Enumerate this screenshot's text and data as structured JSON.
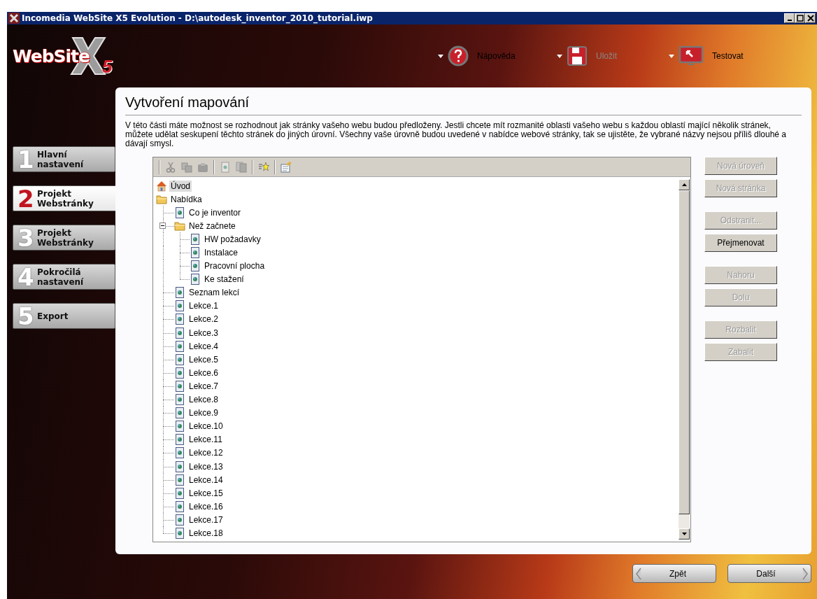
{
  "window": {
    "title": "Incomedia WebSite X5 Evolution - D:\\autodesk_inventor_2010_tutorial.iwp"
  },
  "logo": {
    "text": "WebSite",
    "number": "5"
  },
  "header_actions": [
    {
      "kind": "help",
      "label": "Nápověda",
      "disabled": false
    },
    {
      "kind": "save",
      "label": "Uložit",
      "disabled": true
    },
    {
      "kind": "test",
      "label": "Testovat",
      "disabled": false
    }
  ],
  "steps": [
    {
      "number": "1",
      "label": "Hlavní nastavení",
      "selected": false
    },
    {
      "number": "2",
      "label": "Projekt Webstránky",
      "selected": true
    },
    {
      "number": "3",
      "label": "Projekt Webstránky",
      "selected": false
    },
    {
      "number": "4",
      "label": "Pokročilá nastavení",
      "selected": false
    },
    {
      "number": "5",
      "label": "Export",
      "selected": false
    }
  ],
  "page": {
    "title": "Vytvoření mapování",
    "description": "V této části máte možnost se rozhodnout jak stránky vašeho webu budou předloženy. Jestli chcete mít rozmanité oblasti vašeho webu s každou oblastí mající několik stránek, můžete udělat seskupení těchto stránek do jiných úrovní. Všechny vaše úrovně budou uvedené v nabídce webové stránky, tak se ujistěte, že vybrané názvy nejsou příliš dlouhé a dávají smysl."
  },
  "toolbar": [
    {
      "kind": "cut",
      "disabled": true
    },
    {
      "kind": "copy",
      "disabled": true
    },
    {
      "kind": "paste",
      "disabled": true
    },
    {
      "kind": "separator"
    },
    {
      "kind": "page",
      "disabled": true
    },
    {
      "kind": "pages",
      "disabled": true
    },
    {
      "kind": "separator"
    },
    {
      "kind": "star",
      "disabled": false
    },
    {
      "kind": "separator"
    },
    {
      "kind": "properties",
      "disabled": false
    }
  ],
  "tree": [
    {
      "label": "Úvod",
      "kind": "home",
      "selected": true
    },
    {
      "label": "Nabídka",
      "kind": "folder",
      "selected": false,
      "children": [
        {
          "label": "Co je inventor",
          "kind": "page",
          "selected": false
        },
        {
          "label": "Než začnete",
          "kind": "folder",
          "selected": false,
          "children": [
            {
              "label": "HW požadavky",
              "kind": "page",
              "selected": false
            },
            {
              "label": "Instalace",
              "kind": "page",
              "selected": false
            },
            {
              "label": "Pracovní plocha",
              "kind": "page",
              "selected": false
            },
            {
              "label": "Ke stažení",
              "kind": "page",
              "selected": false
            }
          ]
        },
        {
          "label": "Seznam lekcí",
          "kind": "page",
          "selected": false
        },
        {
          "label": "Lekce.1",
          "kind": "page",
          "selected": false
        },
        {
          "label": "Lekce.2",
          "kind": "page",
          "selected": false
        },
        {
          "label": "Lekce.3",
          "kind": "page",
          "selected": false
        },
        {
          "label": "Lekce.4",
          "kind": "page",
          "selected": false
        },
        {
          "label": "Lekce.5",
          "kind": "page",
          "selected": false
        },
        {
          "label": "Lekce.6",
          "kind": "page",
          "selected": false
        },
        {
          "label": "Lekce.7",
          "kind": "page",
          "selected": false
        },
        {
          "label": "Lekce.8",
          "kind": "page",
          "selected": false
        },
        {
          "label": "Lekce.9",
          "kind": "page",
          "selected": false
        },
        {
          "label": "Lekce.10",
          "kind": "page",
          "selected": false
        },
        {
          "label": "Lekce.11",
          "kind": "page",
          "selected": false
        },
        {
          "label": "Lekce.12",
          "kind": "page",
          "selected": false
        },
        {
          "label": "Lekce.13",
          "kind": "page",
          "selected": false
        },
        {
          "label": "Lekce.14",
          "kind": "page",
          "selected": false
        },
        {
          "label": "Lekce.15",
          "kind": "page",
          "selected": false
        },
        {
          "label": "Lekce.16",
          "kind": "page",
          "selected": false
        },
        {
          "label": "Lekce.17",
          "kind": "page",
          "selected": false
        },
        {
          "label": "Lekce.18",
          "kind": "page",
          "selected": false
        }
      ]
    }
  ],
  "side_button_groups": [
    [
      {
        "label": "Nová úroveň",
        "disabled": true
      },
      {
        "label": "Nová stránka",
        "disabled": true
      }
    ],
    [
      {
        "label": "Odstranit...",
        "disabled": true
      },
      {
        "label": "Přejmenovat",
        "disabled": false
      }
    ],
    [
      {
        "label": "Nahoru",
        "disabled": true
      },
      {
        "label": "Dolu",
        "disabled": true
      }
    ],
    [
      {
        "label": "Rozbalit",
        "disabled": true
      },
      {
        "label": "Zabalit",
        "disabled": true
      }
    ]
  ],
  "nav": {
    "back": "Zpět",
    "next": "Další"
  }
}
